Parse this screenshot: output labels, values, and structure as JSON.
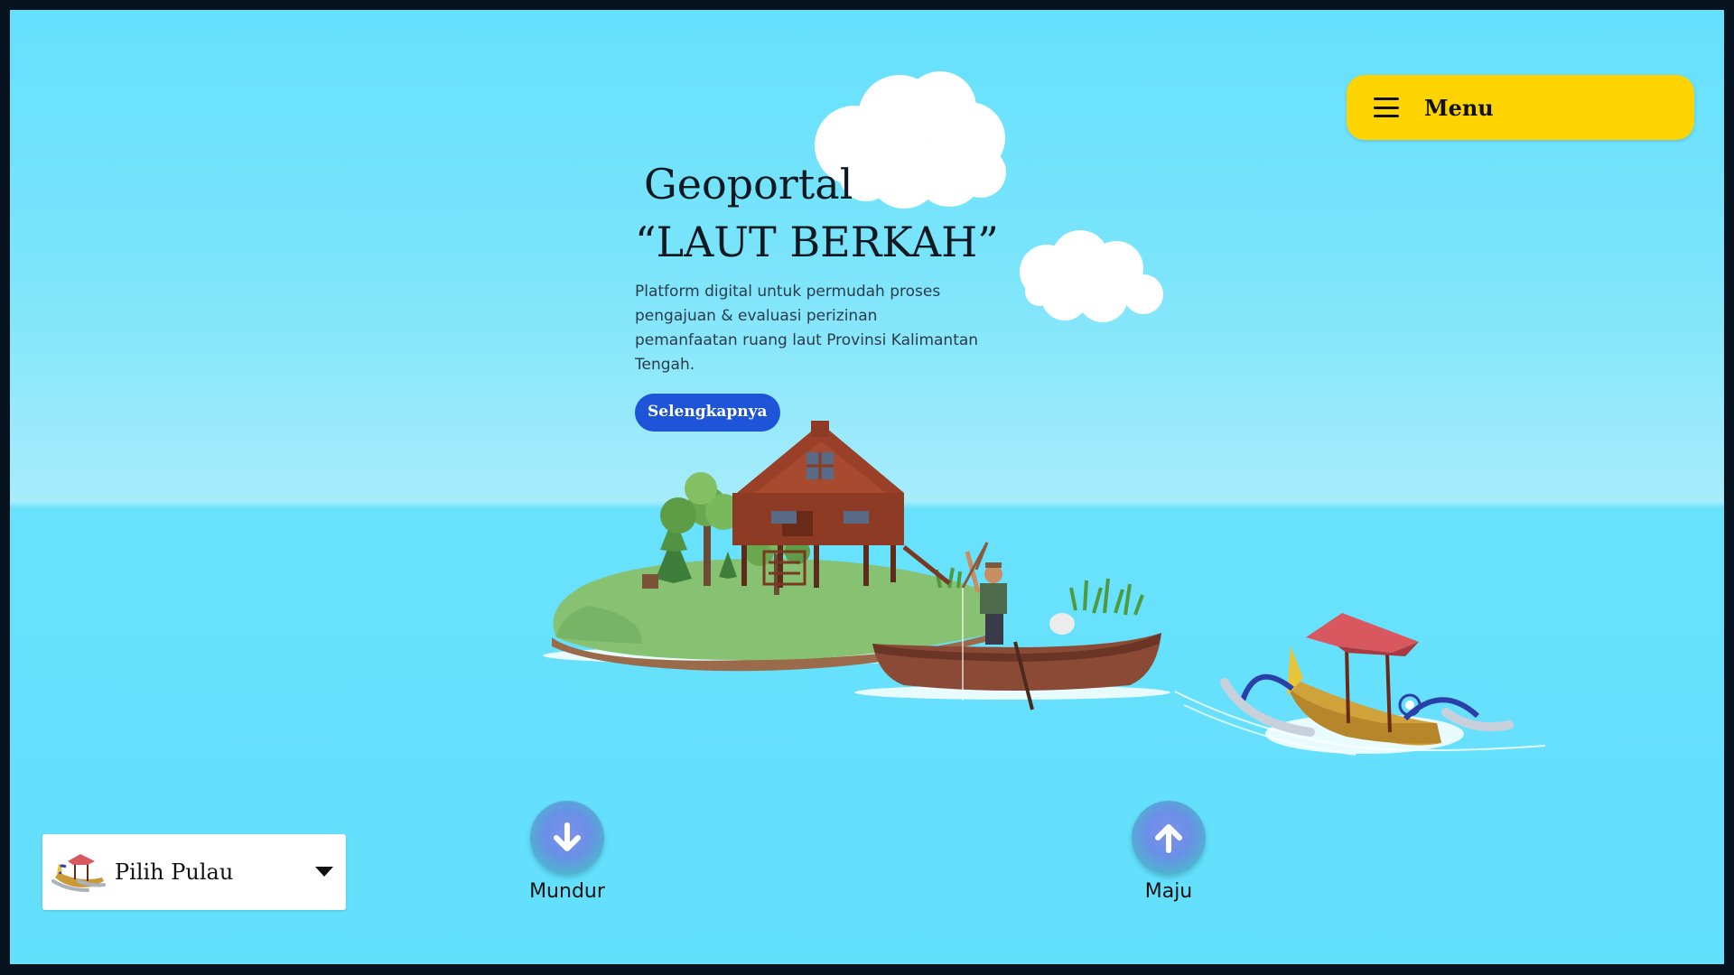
{
  "header": {
    "menu_label": "Menu",
    "menu_icon": "hamburger-icon",
    "menu_color": "#fed400"
  },
  "hero": {
    "title_line1": "Geoportal",
    "title_line2": "“LAUT BERKAH”",
    "description": "Platform digital untuk permudah proses pengajuan & evaluasi perizinan pemanfaatan ruang laut Provinsi Kalimantan Tengah.",
    "cta_label": "Selengkapnya",
    "cta_color": "#1e54d8"
  },
  "island_select": {
    "value": "Pilih Pulau",
    "icon": "boat-icon",
    "dropdown_icon": "caret-down-icon"
  },
  "navigation": {
    "back_label": "Mundur",
    "back_icon": "arrow-down-icon",
    "forward_label": "Maju",
    "forward_icon": "arrow-up-icon"
  },
  "colors": {
    "sky": "#65e0fc",
    "sea": "#63e0fc",
    "horizon": "#a6ecfb"
  }
}
